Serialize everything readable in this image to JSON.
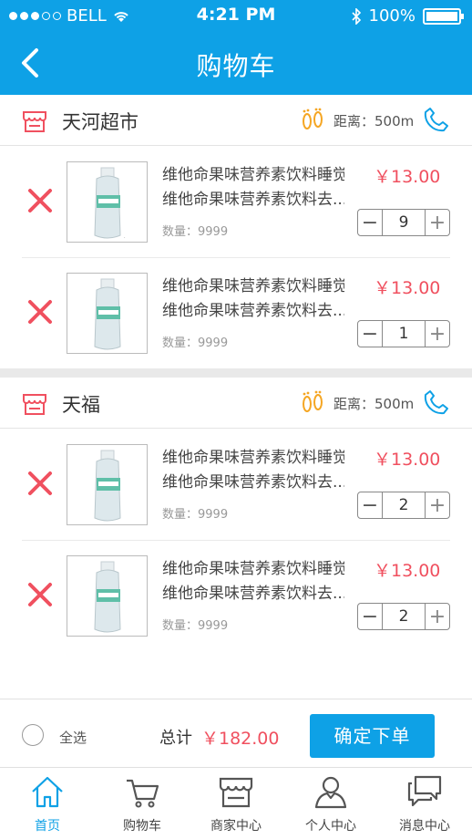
{
  "status_bar": {
    "carrier": "BELL",
    "time": "4:21 PM",
    "battery": "100%"
  },
  "nav": {
    "title": "购物车"
  },
  "shops": [
    {
      "name": "天河超市",
      "distance": "距离：500m",
      "items": [
        {
          "name_line1": "维他命果味营养素饮料睡觉",
          "name_line2": "维他命果味营养素饮料去...",
          "qty_label": "数量：9999",
          "price": "￥13.00",
          "count": "9"
        },
        {
          "name_line1": "维他命果味营养素饮料睡觉",
          "name_line2": "维他命果味营养素饮料去...",
          "qty_label": "数量：9999",
          "price": "￥13.00",
          "count": "1"
        }
      ]
    },
    {
      "name": "天福",
      "distance": "距离：500m",
      "items": [
        {
          "name_line1": "维他命果味营养素饮料睡觉",
          "name_line2": "维他命果味营养素饮料去...",
          "qty_label": "数量：9999",
          "price": "￥13.00",
          "count": "2"
        },
        {
          "name_line1": "维他命果味营养素饮料睡觉",
          "name_line2": "维他命果味营养素饮料去...",
          "qty_label": "数量：9999",
          "price": "￥13.00",
          "count": "2"
        }
      ]
    }
  ],
  "footer": {
    "select_all": "全选",
    "total_label": "总计",
    "total_value": "￥182.00",
    "confirm": "确定下单"
  },
  "tabs": [
    {
      "label": "首页",
      "icon": "home-icon"
    },
    {
      "label": "购物车",
      "icon": "cart-icon"
    },
    {
      "label": "商家中心",
      "icon": "store-icon"
    },
    {
      "label": "个人中心",
      "icon": "person-icon"
    },
    {
      "label": "消息中心",
      "icon": "message-icon"
    }
  ],
  "colors": {
    "primary": "#0ea1e6",
    "price": "#f0505f",
    "delete": "#f0505f",
    "distance_icon": "#f5a623"
  }
}
